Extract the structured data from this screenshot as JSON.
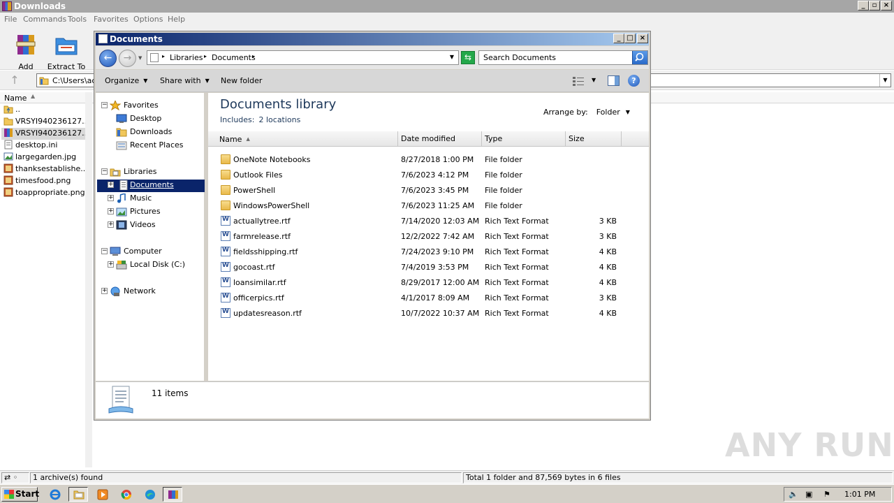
{
  "rar": {
    "title": "Downloads",
    "menu": [
      "File",
      "Commands",
      "Tools",
      "Favorites",
      "Options",
      "Help"
    ],
    "toolbar": {
      "add_label": "Add",
      "extract_label": "Extract To"
    },
    "path": "C:\\Users\\ac",
    "column_name": "Name",
    "files": [
      {
        "name": "..",
        "icon": "up-folder-icon",
        "selected": false
      },
      {
        "name": "VRSYI940236127...",
        "icon": "folder-icon",
        "selected": false
      },
      {
        "name": "VRSYI940236127...",
        "icon": "rar-archive-icon",
        "selected": true
      },
      {
        "name": "desktop.ini",
        "icon": "ini-file-icon",
        "selected": false
      },
      {
        "name": "largegarden.jpg",
        "icon": "image-file-icon",
        "selected": false
      },
      {
        "name": "thanksestablishe...",
        "icon": "image-file-icon",
        "selected": false
      },
      {
        "name": "timesfood.png",
        "icon": "image-file-icon",
        "selected": false
      },
      {
        "name": "toappropriate.png",
        "icon": "image-file-icon",
        "selected": false
      }
    ],
    "status_left": "1 archive(s) found",
    "status_right": "Total 1 folder and 87,569 bytes in 6 files"
  },
  "explorer": {
    "title": "Documents",
    "breadcrumb": [
      "Libraries",
      "Documents"
    ],
    "search_placeholder": "Search Documents",
    "commands": {
      "organize": "Organize",
      "share_with": "Share with",
      "new_folder": "New folder"
    },
    "nav_tree": [
      {
        "label": "Favorites",
        "level": 0,
        "expander": "−",
        "icon": "star-icon"
      },
      {
        "label": "Desktop",
        "level": 1,
        "icon": "desktop-icon"
      },
      {
        "label": "Downloads",
        "level": 1,
        "icon": "downloads-folder-icon"
      },
      {
        "label": "Recent Places",
        "level": 1,
        "icon": "recent-places-icon"
      },
      {
        "label": "Libraries",
        "level": 0,
        "expander": "−",
        "icon": "libraries-icon"
      },
      {
        "label": "Documents",
        "level": 1,
        "expander": "+",
        "icon": "documents-icon",
        "selected": true
      },
      {
        "label": "Music",
        "level": 1,
        "expander": "+",
        "icon": "music-icon"
      },
      {
        "label": "Pictures",
        "level": 1,
        "expander": "+",
        "icon": "pictures-icon"
      },
      {
        "label": "Videos",
        "level": 1,
        "expander": "+",
        "icon": "videos-icon"
      },
      {
        "label": "Computer",
        "level": 0,
        "expander": "−",
        "icon": "computer-icon"
      },
      {
        "label": "Local Disk (C:)",
        "level": 1,
        "expander": "+",
        "icon": "local-disk-icon"
      },
      {
        "label": "Network",
        "level": 0,
        "expander": "+",
        "icon": "network-icon"
      }
    ],
    "library_title": "Documents library",
    "includes_label": "Includes:",
    "includes_value": "2 locations",
    "arrange_label": "Arrange by:",
    "arrange_value": "Folder",
    "columns": [
      "Name",
      "Date modified",
      "Type",
      "Size"
    ],
    "files": [
      {
        "name": "OneNote Notebooks",
        "date": "8/27/2018 1:00 PM",
        "type": "File folder",
        "size": "",
        "kind": "folder"
      },
      {
        "name": "Outlook Files",
        "date": "7/6/2023 4:12 PM",
        "type": "File folder",
        "size": "",
        "kind": "folder"
      },
      {
        "name": "PowerShell",
        "date": "7/6/2023 3:45 PM",
        "type": "File folder",
        "size": "",
        "kind": "folder"
      },
      {
        "name": "WindowsPowerShell",
        "date": "7/6/2023 11:25 AM",
        "type": "File folder",
        "size": "",
        "kind": "folder"
      },
      {
        "name": "actuallytree.rtf",
        "date": "7/14/2020 12:03 AM",
        "type": "Rich Text Format",
        "size": "3 KB",
        "kind": "rtf"
      },
      {
        "name": "farmrelease.rtf",
        "date": "12/2/2022 7:42 AM",
        "type": "Rich Text Format",
        "size": "3 KB",
        "kind": "rtf"
      },
      {
        "name": "fieldsshipping.rtf",
        "date": "7/24/2023 9:10 PM",
        "type": "Rich Text Format",
        "size": "4 KB",
        "kind": "rtf"
      },
      {
        "name": "gocoast.rtf",
        "date": "7/4/2019 3:53 PM",
        "type": "Rich Text Format",
        "size": "4 KB",
        "kind": "rtf"
      },
      {
        "name": "loansimilar.rtf",
        "date": "8/29/2017 12:00 AM",
        "type": "Rich Text Format",
        "size": "4 KB",
        "kind": "rtf"
      },
      {
        "name": "officerpics.rtf",
        "date": "4/1/2017 8:09 AM",
        "type": "Rich Text Format",
        "size": "3 KB",
        "kind": "rtf"
      },
      {
        "name": "updatesreason.rtf",
        "date": "10/7/2022 10:37 AM",
        "type": "Rich Text Format",
        "size": "4 KB",
        "kind": "rtf"
      }
    ],
    "item_count": "11 items"
  },
  "taskbar": {
    "start_label": "Start",
    "apps": [
      "internet-explorer-icon",
      "file-explorer-icon",
      "media-player-icon",
      "chrome-icon",
      "edge-icon",
      "winrar-icon"
    ],
    "clock": "1:01 PM"
  },
  "watermark": "ANY RUN",
  "colors": {
    "title_active_start": "#0a246a",
    "title_active_end": "#a6caf0",
    "selection": "#0a246a",
    "library_text": "#1e395b"
  }
}
